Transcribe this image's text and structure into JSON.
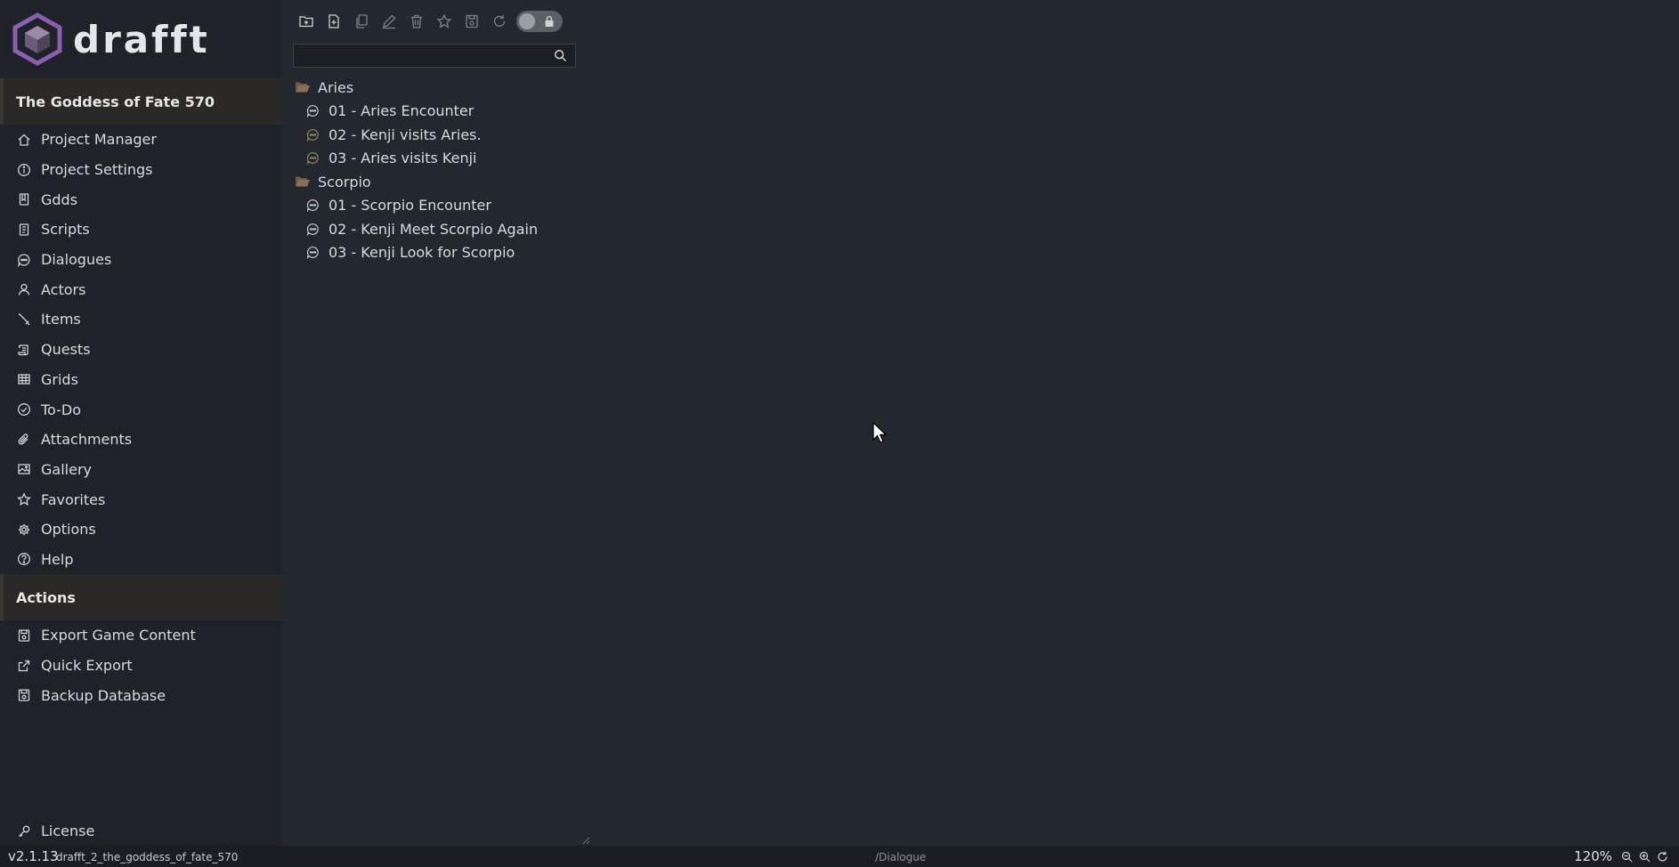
{
  "app": {
    "name": "drafft",
    "brand_color": "#8a5fb0"
  },
  "sidebar": {
    "project_title": "The Goddess of Fate 570",
    "nav": [
      {
        "label": "Project Manager",
        "icon": "home-icon"
      },
      {
        "label": "Project Settings",
        "icon": "info-icon"
      },
      {
        "label": "Gdds",
        "icon": "book-icon"
      },
      {
        "label": "Scripts",
        "icon": "script-icon"
      },
      {
        "label": "Dialogues",
        "icon": "chat-icon"
      },
      {
        "label": "Actors",
        "icon": "user-icon"
      },
      {
        "label": "Items",
        "icon": "sword-icon"
      },
      {
        "label": "Quests",
        "icon": "scroll-icon"
      },
      {
        "label": "Grids",
        "icon": "grid-icon"
      },
      {
        "label": "To-Do",
        "icon": "check-circle-icon"
      },
      {
        "label": "Attachments",
        "icon": "paperclip-icon"
      },
      {
        "label": "Gallery",
        "icon": "image-icon"
      },
      {
        "label": "Favorites",
        "icon": "star-icon"
      },
      {
        "label": "Options",
        "icon": "gear-icon"
      },
      {
        "label": "Help",
        "icon": "help-icon"
      }
    ],
    "actions_header": "Actions",
    "actions": [
      {
        "label": "Export Game Content",
        "icon": "export-icon"
      },
      {
        "label": "Quick Export",
        "icon": "external-link-icon"
      },
      {
        "label": "Backup Database",
        "icon": "database-icon"
      }
    ],
    "license": "License"
  },
  "toolbar": {
    "buttons": [
      "new-folder-icon",
      "new-file-icon",
      "duplicate-icon",
      "edit-icon",
      "trash-icon",
      "star-icon",
      "save-icon",
      "refresh-icon"
    ],
    "lock_toggle_on": false
  },
  "search": {
    "value": "",
    "placeholder": ""
  },
  "tree": [
    {
      "folder": "Aries",
      "items": [
        "01 - Aries Encounter",
        "02 - Kenji visits Aries.",
        "03 - Aries visits Kenji"
      ]
    },
    {
      "folder": "Scorpio",
      "items": [
        "01 - Scorpio Encounter",
        "02 - Kenji Meet Scorpio Again",
        "03 - Kenji Look for Scorpio"
      ]
    }
  ],
  "status": {
    "version": "v2.1.13",
    "database": "drafft_2_the_goddess_of_fate_570",
    "route": "/Dialogue",
    "zoom": "120%"
  }
}
